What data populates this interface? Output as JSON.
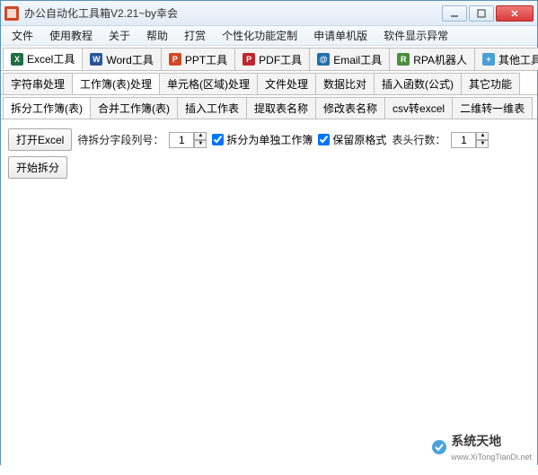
{
  "window": {
    "title": "办公自动化工具箱V2.21~by幸会"
  },
  "menu": {
    "items": [
      "文件",
      "使用教程",
      "关于",
      "帮助",
      "打赏",
      "个性化功能定制",
      "申请单机版",
      "软件显示异常"
    ]
  },
  "mainTabs": [
    {
      "label": "Excel工具",
      "icon": "excel",
      "color": "#1e6f42"
    },
    {
      "label": "Word工具",
      "icon": "word",
      "color": "#2a5699"
    },
    {
      "label": "PPT工具",
      "icon": "ppt",
      "color": "#d24726"
    },
    {
      "label": "PDF工具",
      "icon": "pdf",
      "color": "#c1272d"
    },
    {
      "label": "Email工具",
      "icon": "email",
      "color": "#1f6fb0"
    },
    {
      "label": "RPA机器人",
      "icon": "rpa",
      "color": "#4b8f3c"
    },
    {
      "label": "其他工具",
      "icon": "other",
      "color": "#49a0d8"
    }
  ],
  "mainTabActive": 0,
  "subTabs": [
    "字符串处理",
    "工作簿(表)处理",
    "单元格(区域)处理",
    "文件处理",
    "数据比对",
    "插入函数(公式)",
    "其它功能"
  ],
  "subTabActive": 1,
  "thirdTabs": [
    "拆分工作簿(表)",
    "合并工作簿(表)",
    "插入工作表",
    "提取表名称",
    "修改表名称",
    "csv转excel",
    "二维转一维表"
  ],
  "thirdTabActive": 0,
  "panel": {
    "openExcelBtn": "打开Excel",
    "splitFieldLabel": "待拆分字段列号：",
    "splitFieldValue": "1",
    "splitAsStandaloneLabel": "拆分为单独工作簿",
    "splitAsStandaloneChecked": true,
    "keepFormatLabel": "保留原格式",
    "keepFormatChecked": true,
    "headerRowsLabel": "表头行数：",
    "headerRowsValue": "1",
    "startSplitBtn": "开始拆分"
  },
  "branding": {
    "name": "系统天地",
    "url": "www.XiTongTianDi.net"
  }
}
